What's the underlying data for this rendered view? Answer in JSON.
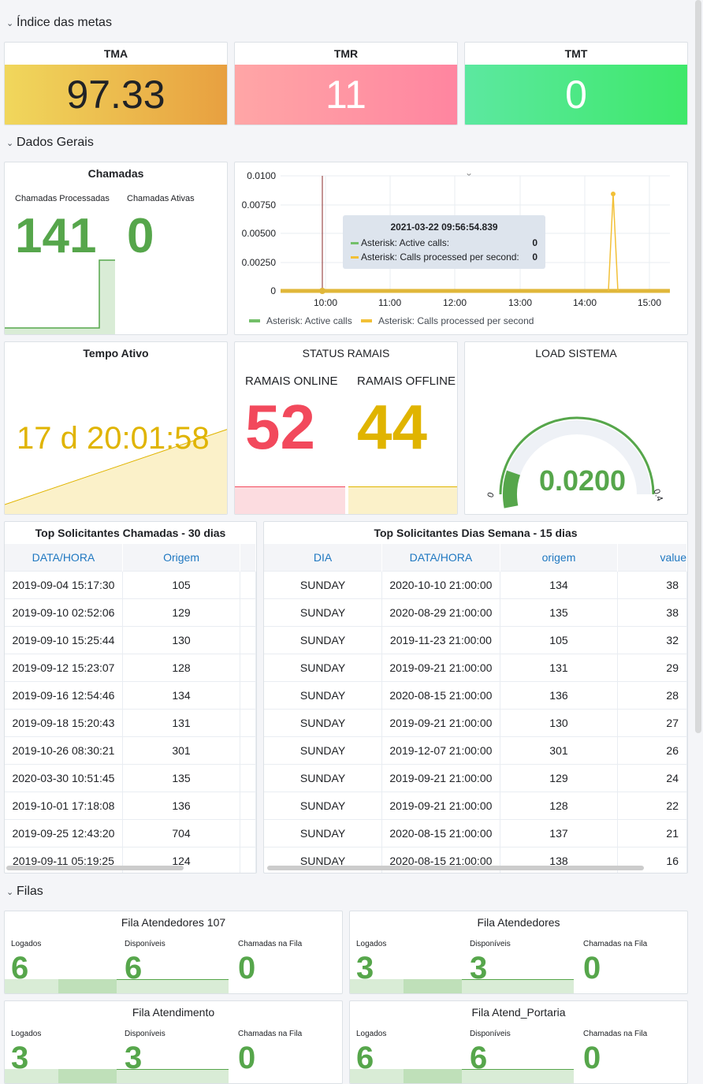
{
  "rows": {
    "metas": "Índice das metas",
    "gerais": "Dados Gerais",
    "filas": "Filas"
  },
  "colors": {
    "green": "#56a64b",
    "yellow": "#e0b400",
    "red": "#f2495c",
    "blue": "#1f78c1"
  },
  "stats": {
    "tma": {
      "title": "TMA",
      "value": "97.33"
    },
    "tmr": {
      "title": "TMR",
      "value": "11"
    },
    "tmt": {
      "title": "TMT",
      "value": "0"
    }
  },
  "chamadas": {
    "title": "Chamadas",
    "processadas_label": "Chamadas Processadas",
    "processadas_value": "141",
    "ativas_label": "Chamadas Ativas",
    "ativas_value": "0"
  },
  "graph": {
    "y_ticks": [
      "0.0100",
      "0.00750",
      "0.00500",
      "0.00250",
      "0"
    ],
    "x_ticks": [
      "10:00",
      "11:00",
      "12:00",
      "13:00",
      "14:00",
      "15:00"
    ],
    "tooltip": {
      "time": "2021-03-22 09:56:54.839",
      "rows": [
        {
          "label": "Asterisk: Active calls:",
          "value": "0"
        },
        {
          "label": "Asterisk: Calls processed per second:",
          "value": "0"
        }
      ]
    },
    "legend": [
      "Asterisk: Active calls",
      "Asterisk: Calls processed per second"
    ],
    "series_colors": [
      "#73bf69",
      "#f2c037"
    ]
  },
  "tempo": {
    "title": "Tempo Ativo",
    "value": "17 d 20:01:58"
  },
  "ramais": {
    "title": "STATUS RAMAIS",
    "online_label": "RAMAIS ONLINE",
    "online_value": "52",
    "offline_label": "RAMAIS OFFLINE",
    "offline_value": "44"
  },
  "load": {
    "title": "LOAD SISTEMA",
    "value": "0.0200",
    "min": "0",
    "max": "0.4",
    "level": 0.05
  },
  "top30": {
    "title": "Top Solicitantes Chamadas - 30 dias",
    "headers": [
      "DATA/HORA",
      "Origem"
    ],
    "rows": [
      [
        "2019-09-04 15:17:30",
        "105"
      ],
      [
        "2019-09-10 02:52:06",
        "129"
      ],
      [
        "2019-09-10 15:25:44",
        "130"
      ],
      [
        "2019-09-12 15:23:07",
        "128"
      ],
      [
        "2019-09-16 12:54:46",
        "134"
      ],
      [
        "2019-09-18 15:20:43",
        "131"
      ],
      [
        "2019-10-26 08:30:21",
        "301"
      ],
      [
        "2020-03-30 10:51:45",
        "135"
      ],
      [
        "2019-10-01 17:18:08",
        "136"
      ],
      [
        "2019-09-25 12:43:20",
        "704"
      ],
      [
        "2019-09-11 05:19:25",
        "124"
      ]
    ]
  },
  "top15": {
    "title": "Top Solicitantes Dias Semana - 15 dias",
    "headers": [
      "DIA",
      "DATA/HORA",
      "origem",
      "value"
    ],
    "rows": [
      [
        "SUNDAY",
        "2020-10-10 21:00:00",
        "134",
        "38"
      ],
      [
        "SUNDAY",
        "2020-08-29 21:00:00",
        "135",
        "38"
      ],
      [
        "SUNDAY",
        "2019-11-23 21:00:00",
        "105",
        "32"
      ],
      [
        "SUNDAY",
        "2019-09-21 21:00:00",
        "131",
        "29"
      ],
      [
        "SUNDAY",
        "2020-08-15 21:00:00",
        "136",
        "28"
      ],
      [
        "SUNDAY",
        "2019-09-21 21:00:00",
        "130",
        "27"
      ],
      [
        "SUNDAY",
        "2019-12-07 21:00:00",
        "301",
        "26"
      ],
      [
        "SUNDAY",
        "2019-09-21 21:00:00",
        "129",
        "24"
      ],
      [
        "SUNDAY",
        "2019-09-21 21:00:00",
        "128",
        "22"
      ],
      [
        "SUNDAY",
        "2020-08-15 21:00:00",
        "137",
        "21"
      ],
      [
        "SUNDAY",
        "2020-08-15 21:00:00",
        "138",
        "16"
      ]
    ]
  },
  "filas": [
    {
      "title": "Fila Atendedores 107",
      "logados": "6",
      "disponiveis": "6",
      "na_fila": "0"
    },
    {
      "title": "Fila Atendedores",
      "logados": "3",
      "disponiveis": "3",
      "na_fila": "0"
    },
    {
      "title": "Fila Atendimento",
      "logados": "3",
      "disponiveis": "3",
      "na_fila": "0"
    },
    {
      "title": "Fila Atend_Portaria",
      "logados": "6",
      "disponiveis": "6",
      "na_fila": "0"
    }
  ],
  "fila_labels": {
    "logados": "Logados",
    "disponiveis": "Disponíveis",
    "na_fila": "Chamadas na Fila"
  }
}
